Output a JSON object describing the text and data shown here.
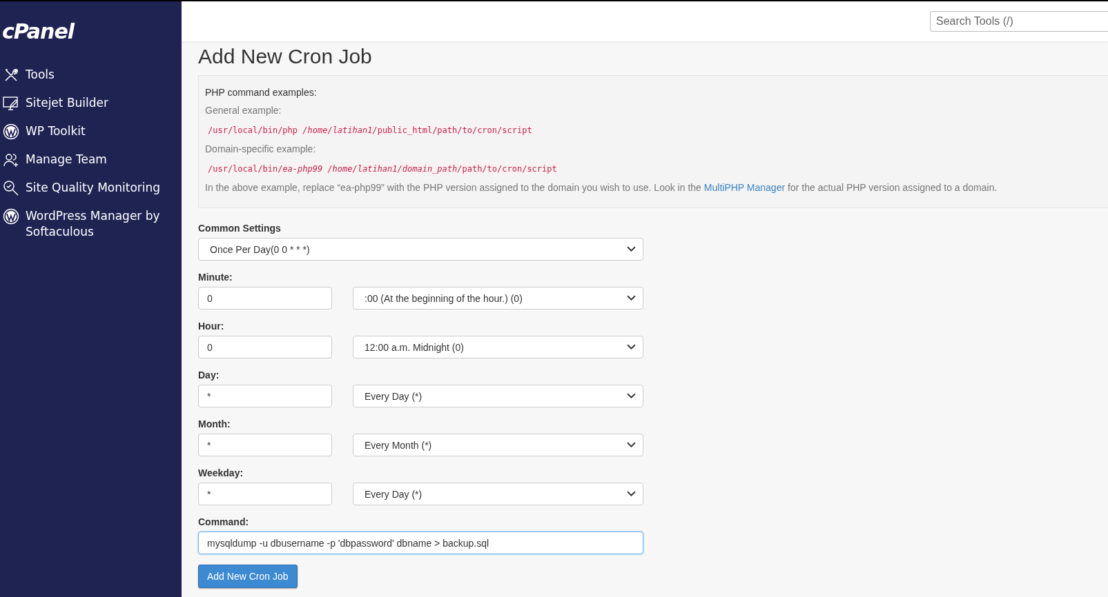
{
  "sidebar": {
    "logo": "cPanel",
    "items": [
      {
        "label": "Tools",
        "kind": "tools"
      },
      {
        "label": "Sitejet Builder",
        "kind": "monitor"
      },
      {
        "label": "WP Toolkit",
        "kind": "wordpress"
      },
      {
        "label": "Manage Team",
        "kind": "team"
      },
      {
        "label": "Site Quality Monitoring",
        "kind": "magnifier"
      },
      {
        "label": "WordPress Manager by Softaculous",
        "kind": "wordpress"
      }
    ]
  },
  "header": {
    "search": {
      "placeholder": "Search Tools (/)"
    }
  },
  "page": {
    "title": "Add New Cron Job",
    "examples": {
      "heading": "PHP command examples:",
      "items": [
        {
          "label": "General example:",
          "code": [
            {
              "text": "/usr/local/bin/php ",
              "italic": false
            },
            {
              "text": "/home/latihan1/",
              "italic": true
            },
            {
              "text": "public_html/path/to/cron/script",
              "italic": false
            }
          ]
        },
        {
          "label": "Domain-specific example:",
          "code": [
            {
              "text": "/usr/local/bin/",
              "italic": false
            },
            {
              "text": "ea-php99 /home/latihan1/domain_path/",
              "italic": true
            },
            {
              "text": "path/to/cron/script",
              "italic": false
            }
          ]
        }
      ],
      "note_before": "In the above example, replace “ea-php99” with the PHP version assigned to the domain you wish to use. Look in the",
      "note_link": "MultiPHP Manager",
      "note_after": "for the actual PHP version assigned to a domain."
    },
    "common_settings": {
      "label": "Common Settings",
      "value": "Once Per Day(0 0 * * *)"
    },
    "fields": [
      {
        "label": "Minute:",
        "value": "0",
        "option": ":00 (At the beginning of the hour.) (0)"
      },
      {
        "label": "Hour:",
        "value": "0",
        "option": "12:00 a.m. Midnight (0)"
      },
      {
        "label": "Day:",
        "value": "*",
        "option": "Every Day (*)"
      },
      {
        "label": "Month:",
        "value": "*",
        "option": "Every Month (*)"
      },
      {
        "label": "Weekday:",
        "value": "*",
        "option": "Every Day (*)"
      }
    ],
    "command": {
      "label": "Command:",
      "value": "mysqldump -u dbusername -p 'dbpassword' dbname > backup.sql"
    },
    "submit": "Add New Cron Job"
  }
}
